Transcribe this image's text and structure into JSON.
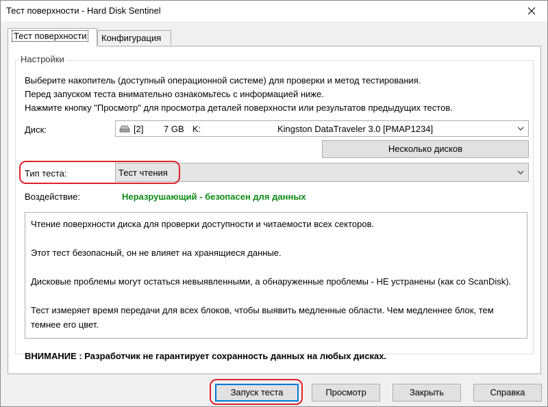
{
  "window": {
    "title": "Тест поверхности - Hard Disk Sentinel"
  },
  "tabs": [
    {
      "label": "Тест поверхности",
      "active": true
    },
    {
      "label": "Конфигурация",
      "active": false
    }
  ],
  "settings": {
    "legend": "Настройки",
    "info_lines": [
      "Выберите накопитель (доступный операционной системе) для проверки и метод тестирования.",
      "Перед запуском теста внимательно ознакомьтесь с информацией ниже.",
      "Нажмите кнопку \"Просмотр\" для просмотра деталей поверхности или результатов предыдущих тестов."
    ],
    "disk_label": "Диск:",
    "disk": {
      "index": "[2]",
      "size": "7 GB",
      "letter": "K:",
      "model": "Kingston DataTraveler 3.0 [PMAP1234]"
    },
    "multi_disk_button": "Несколько дисков",
    "test_type_label": "Тип теста:",
    "test_type_value": "Тест чтения",
    "effect_label": "Воздействие:",
    "effect_value": "Неразрушающий - безопасен для данных",
    "description": [
      "Чтение поверхности диска для проверки доступности и читаемости всех секторов.",
      "Этот тест безопасный, он не влияет на хранящиеся данные.",
      "Дисковые проблемы могут остаться невыявленными, а обнаруженные проблемы - НЕ устранены (как со ScanDisk).",
      "Тест измеряет время передачи для всех блоков, чтобы выявить медленные области. Чем медленнее блок, тем темнее его цвет."
    ],
    "warning": "ВНИМАНИЕ : Разработчик не гарантирует сохранность данных на любых дисках."
  },
  "buttons": {
    "start_test": "Запуск теста",
    "view": "Просмотр",
    "close": "Закрыть",
    "help": "Справка"
  },
  "colors": {
    "effect_green": "#0e8a16",
    "highlight_red": "#e0202a",
    "focus_blue": "#0078d7"
  }
}
